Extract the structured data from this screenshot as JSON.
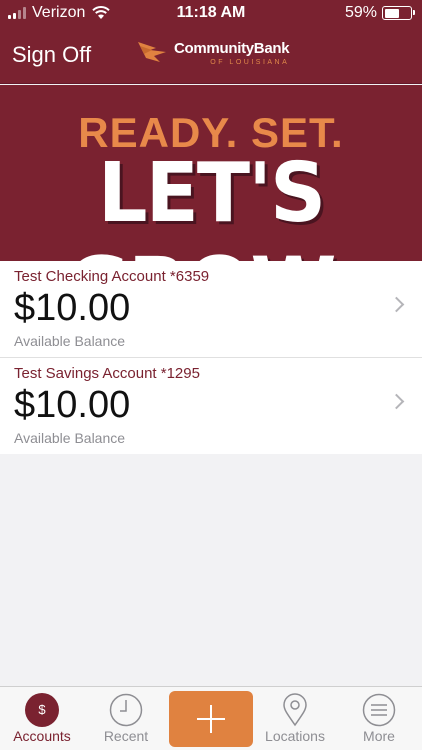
{
  "status_bar": {
    "carrier": "Verizon",
    "time": "11:18 AM",
    "battery": "59%",
    "battery_level": 0.59
  },
  "nav": {
    "sign_off_label": "Sign Off",
    "logo_name": "CommunityBank",
    "logo_sub": "OF LOUISIANA"
  },
  "banner": {
    "line1": "READY. SET.",
    "line2": "LET'S GROW."
  },
  "accounts": [
    {
      "name": "Test Checking Account *6359",
      "balance": "$10.00",
      "label": "Available Balance"
    },
    {
      "name": "Test Savings Account *1295",
      "balance": "$10.00",
      "label": "Available Balance"
    }
  ],
  "tabs": {
    "accounts": "Accounts",
    "recent": "Recent",
    "locations": "Locations",
    "more": "More",
    "accounts_icon_text": "$"
  },
  "icons": {
    "accounts": "dollar-circle-icon",
    "recent": "clock-icon",
    "add": "plus-icon",
    "locations": "map-pin-icon",
    "more": "menu-icon"
  },
  "colors": {
    "brand": "#7a2230",
    "accent": "#e08240"
  }
}
